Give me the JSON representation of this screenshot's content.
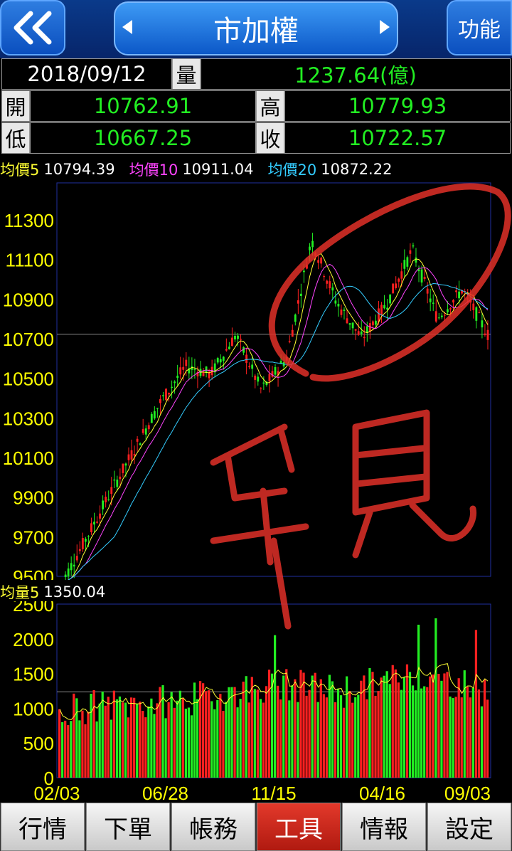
{
  "header": {
    "title": "市加權",
    "func_label": "功能"
  },
  "quote": {
    "date": "2018/09/12",
    "volume_label": "量",
    "volume": "1237.64(億)",
    "open_label": "開",
    "open": "10762.91",
    "high_label": "高",
    "high": "10779.93",
    "low_label": "低",
    "low": "10667.25",
    "close_label": "收",
    "close": "10722.57"
  },
  "ma": {
    "ma5_label": "均價5",
    "ma5_value": "10794.39",
    "ma10_label": "均價10",
    "ma10_value": "10911.04",
    "ma20_label": "均價20",
    "ma20_value": "10872.22",
    "vol_ma5_label": "均量5",
    "vol_ma5_value": "1350.04"
  },
  "colors": {
    "ma5": "#ffff33",
    "ma10": "#ff44ff",
    "ma20": "#33ccff",
    "up": "#ff2020",
    "down": "#22ee22",
    "axis_label": "#ffff00",
    "scribble": "#e03028"
  },
  "chart_data": [
    {
      "type": "candlestick",
      "title": "",
      "ylim": [
        9500,
        11300
      ],
      "y_ticks": [
        "11300",
        "11100",
        "10900",
        "10700",
        "10500",
        "10300",
        "10100",
        "9900",
        "9700",
        "9500"
      ],
      "x_ticks": [
        "02/03",
        "06/28",
        "11/15",
        "04/16",
        "09/03"
      ],
      "reference_line": 10722.57,
      "trend_points": [
        {
          "x": "02/03",
          "y": 9450
        },
        {
          "x": "03",
          "y": 9680
        },
        {
          "x": "04",
          "y": 9920
        },
        {
          "x": "05",
          "y": 10150
        },
        {
          "x": "06/28",
          "y": 10380
        },
        {
          "x": "08",
          "y": 10560
        },
        {
          "x": "10",
          "y": 10520
        },
        {
          "x": "11/15",
          "y": 10720
        },
        {
          "x": "12",
          "y": 10440
        },
        {
          "x": "01",
          "y": 10600
        },
        {
          "x": "02",
          "y": 11200
        },
        {
          "x": "03",
          "y": 10880
        },
        {
          "x": "04/16",
          "y": 10700
        },
        {
          "x": "05",
          "y": 10880
        },
        {
          "x": "06",
          "y": 11150
        },
        {
          "x": "07",
          "y": 10800
        },
        {
          "x": "08",
          "y": 10950
        },
        {
          "x": "09/03",
          "y": 10720
        }
      ]
    },
    {
      "type": "bar",
      "title": "",
      "ylim": [
        0,
        2500
      ],
      "y_ticks": [
        "2500",
        "2000",
        "1500",
        "1000",
        "500",
        "0"
      ],
      "x_ticks": [
        "02/03",
        "06/28",
        "11/15",
        "04/16",
        "09/03"
      ],
      "reference_line": 1237.64,
      "trend_points": [
        {
          "x": "02/03",
          "y": 1000
        },
        {
          "x": "06/28",
          "y": 1050
        },
        {
          "x": "11/15",
          "y": 1150
        },
        {
          "x": "01",
          "y": 1350
        },
        {
          "x": "04/16",
          "y": 1250
        },
        {
          "x": "06",
          "y": 1500
        },
        {
          "x": "09/03",
          "y": 1250
        }
      ]
    }
  ],
  "tabs": [
    {
      "label": "行情",
      "active": false
    },
    {
      "label": "下單",
      "active": false
    },
    {
      "label": "帳務",
      "active": false
    },
    {
      "label": "工具",
      "active": true
    },
    {
      "label": "情報",
      "active": false
    },
    {
      "label": "設定",
      "active": false
    }
  ],
  "annotation_text": "罕見"
}
